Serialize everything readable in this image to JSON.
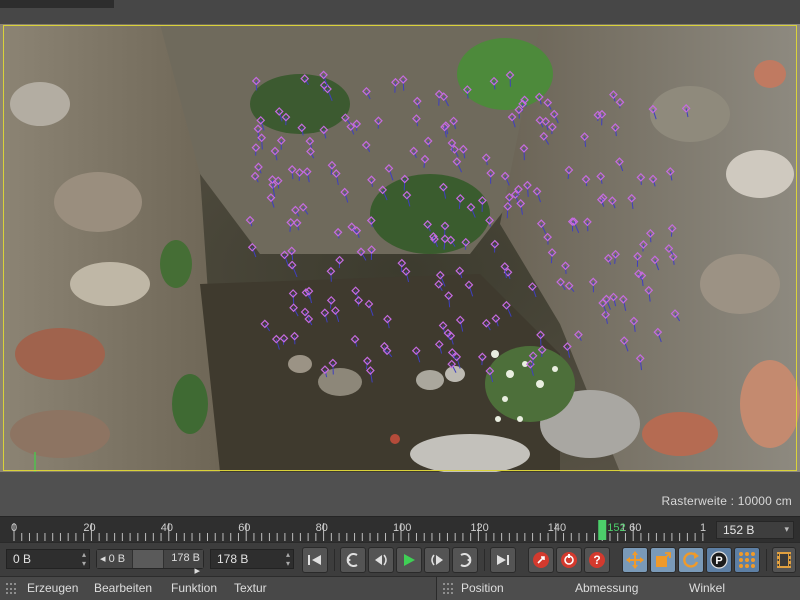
{
  "viewport": {
    "scene": "photo-of-stone-ruin-with-tracking-markers",
    "raster_label": "Rasterweite : 10000 cm",
    "axis_colors": {
      "x": "#e0463c",
      "y": "#4fc24f"
    },
    "frame_color": "#d9d23a",
    "marker_color": "#c56be0"
  },
  "timeline": {
    "ticks": [
      "0",
      "20",
      "40",
      "60",
      "80",
      "100",
      "120",
      "140",
      "152",
      "1"
    ],
    "current_frame": "152",
    "current_frame_field": "152 B",
    "playhead_color": "#4ccf6a"
  },
  "controls": {
    "start_field": "0 B",
    "range_start": "0 B",
    "range_end": "178 B",
    "end_field": "178 B",
    "buttons": [
      "go-to-start",
      "previous-key",
      "previous-frame",
      "play-forward",
      "next-frame",
      "next-key",
      "go-to-end",
      "record-active-objects",
      "autokeying",
      "keyframe-selection",
      "move-key",
      "scale-key",
      "rotate-key",
      "parameter-key",
      "point-level-animation",
      "timeline-window"
    ]
  },
  "menubar": {
    "items": [
      "Erzeugen",
      "Bearbeiten",
      "Funktion",
      "Textur"
    ],
    "panel_headers": [
      "Position",
      "Abmessung",
      "Winkel"
    ]
  }
}
